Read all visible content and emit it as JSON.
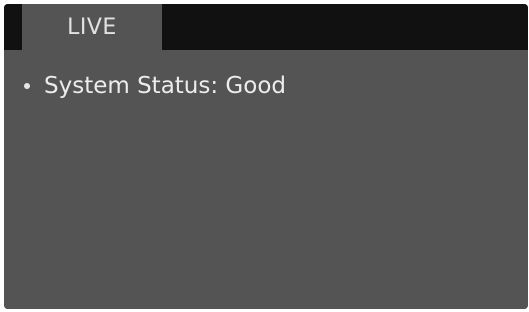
{
  "tabs": [
    {
      "label": "LIVE",
      "active": true
    }
  ],
  "status": {
    "items": [
      {
        "text": "System Status: Good"
      }
    ]
  },
  "colors": {
    "frame_background": "#111111",
    "panel_background": "#545454",
    "text": "#ececec"
  }
}
